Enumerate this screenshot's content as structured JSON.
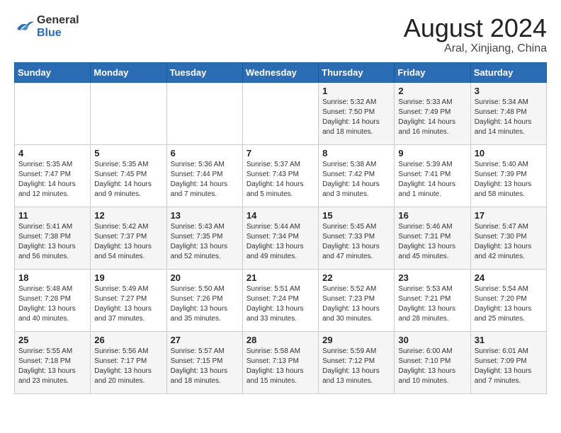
{
  "header": {
    "logo_line1": "General",
    "logo_line2": "Blue",
    "month_year": "August 2024",
    "location": "Aral, Xinjiang, China"
  },
  "weekdays": [
    "Sunday",
    "Monday",
    "Tuesday",
    "Wednesday",
    "Thursday",
    "Friday",
    "Saturday"
  ],
  "weeks": [
    [
      {
        "day": "",
        "content": ""
      },
      {
        "day": "",
        "content": ""
      },
      {
        "day": "",
        "content": ""
      },
      {
        "day": "",
        "content": ""
      },
      {
        "day": "1",
        "content": "Sunrise: 5:32 AM\nSunset: 7:50 PM\nDaylight: 14 hours\nand 18 minutes."
      },
      {
        "day": "2",
        "content": "Sunrise: 5:33 AM\nSunset: 7:49 PM\nDaylight: 14 hours\nand 16 minutes."
      },
      {
        "day": "3",
        "content": "Sunrise: 5:34 AM\nSunset: 7:48 PM\nDaylight: 14 hours\nand 14 minutes."
      }
    ],
    [
      {
        "day": "4",
        "content": "Sunrise: 5:35 AM\nSunset: 7:47 PM\nDaylight: 14 hours\nand 12 minutes."
      },
      {
        "day": "5",
        "content": "Sunrise: 5:35 AM\nSunset: 7:45 PM\nDaylight: 14 hours\nand 9 minutes."
      },
      {
        "day": "6",
        "content": "Sunrise: 5:36 AM\nSunset: 7:44 PM\nDaylight: 14 hours\nand 7 minutes."
      },
      {
        "day": "7",
        "content": "Sunrise: 5:37 AM\nSunset: 7:43 PM\nDaylight: 14 hours\nand 5 minutes."
      },
      {
        "day": "8",
        "content": "Sunrise: 5:38 AM\nSunset: 7:42 PM\nDaylight: 14 hours\nand 3 minutes."
      },
      {
        "day": "9",
        "content": "Sunrise: 5:39 AM\nSunset: 7:41 PM\nDaylight: 14 hours\nand 1 minute."
      },
      {
        "day": "10",
        "content": "Sunrise: 5:40 AM\nSunset: 7:39 PM\nDaylight: 13 hours\nand 58 minutes."
      }
    ],
    [
      {
        "day": "11",
        "content": "Sunrise: 5:41 AM\nSunset: 7:38 PM\nDaylight: 13 hours\nand 56 minutes."
      },
      {
        "day": "12",
        "content": "Sunrise: 5:42 AM\nSunset: 7:37 PM\nDaylight: 13 hours\nand 54 minutes."
      },
      {
        "day": "13",
        "content": "Sunrise: 5:43 AM\nSunset: 7:35 PM\nDaylight: 13 hours\nand 52 minutes."
      },
      {
        "day": "14",
        "content": "Sunrise: 5:44 AM\nSunset: 7:34 PM\nDaylight: 13 hours\nand 49 minutes."
      },
      {
        "day": "15",
        "content": "Sunrise: 5:45 AM\nSunset: 7:33 PM\nDaylight: 13 hours\nand 47 minutes."
      },
      {
        "day": "16",
        "content": "Sunrise: 5:46 AM\nSunset: 7:31 PM\nDaylight: 13 hours\nand 45 minutes."
      },
      {
        "day": "17",
        "content": "Sunrise: 5:47 AM\nSunset: 7:30 PM\nDaylight: 13 hours\nand 42 minutes."
      }
    ],
    [
      {
        "day": "18",
        "content": "Sunrise: 5:48 AM\nSunset: 7:28 PM\nDaylight: 13 hours\nand 40 minutes."
      },
      {
        "day": "19",
        "content": "Sunrise: 5:49 AM\nSunset: 7:27 PM\nDaylight: 13 hours\nand 37 minutes."
      },
      {
        "day": "20",
        "content": "Sunrise: 5:50 AM\nSunset: 7:26 PM\nDaylight: 13 hours\nand 35 minutes."
      },
      {
        "day": "21",
        "content": "Sunrise: 5:51 AM\nSunset: 7:24 PM\nDaylight: 13 hours\nand 33 minutes."
      },
      {
        "day": "22",
        "content": "Sunrise: 5:52 AM\nSunset: 7:23 PM\nDaylight: 13 hours\nand 30 minutes."
      },
      {
        "day": "23",
        "content": "Sunrise: 5:53 AM\nSunset: 7:21 PM\nDaylight: 13 hours\nand 28 minutes."
      },
      {
        "day": "24",
        "content": "Sunrise: 5:54 AM\nSunset: 7:20 PM\nDaylight: 13 hours\nand 25 minutes."
      }
    ],
    [
      {
        "day": "25",
        "content": "Sunrise: 5:55 AM\nSunset: 7:18 PM\nDaylight: 13 hours\nand 23 minutes."
      },
      {
        "day": "26",
        "content": "Sunrise: 5:56 AM\nSunset: 7:17 PM\nDaylight: 13 hours\nand 20 minutes."
      },
      {
        "day": "27",
        "content": "Sunrise: 5:57 AM\nSunset: 7:15 PM\nDaylight: 13 hours\nand 18 minutes."
      },
      {
        "day": "28",
        "content": "Sunrise: 5:58 AM\nSunset: 7:13 PM\nDaylight: 13 hours\nand 15 minutes."
      },
      {
        "day": "29",
        "content": "Sunrise: 5:59 AM\nSunset: 7:12 PM\nDaylight: 13 hours\nand 13 minutes."
      },
      {
        "day": "30",
        "content": "Sunrise: 6:00 AM\nSunset: 7:10 PM\nDaylight: 13 hours\nand 10 minutes."
      },
      {
        "day": "31",
        "content": "Sunrise: 6:01 AM\nSunset: 7:09 PM\nDaylight: 13 hours\nand 7 minutes."
      }
    ]
  ]
}
